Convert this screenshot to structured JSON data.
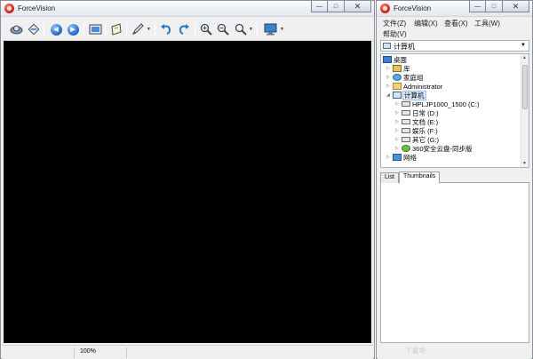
{
  "left_window": {
    "title": "ForceVision",
    "caption": {
      "minimize": "—",
      "maximize": "□",
      "close": "✕"
    },
    "toolbar": [
      {
        "name": "scan-icon",
        "glyph": "⚙"
      },
      {
        "name": "rotate-icon",
        "glyph": "◈"
      },
      {
        "name": "previous-icon",
        "glyph": "◀"
      },
      {
        "name": "next-icon",
        "glyph": "▶"
      },
      {
        "name": "display-icon",
        "glyph": "▭"
      },
      {
        "name": "slideshow-icon",
        "glyph": "⬗"
      },
      {
        "name": "edit-icon",
        "glyph": "✎"
      },
      {
        "name": "undo-icon",
        "glyph": "↶"
      },
      {
        "name": "redo-icon",
        "glyph": "↷"
      },
      {
        "name": "zoom-in-icon",
        "glyph": "⊕"
      },
      {
        "name": "zoom-out-icon",
        "glyph": "⊖"
      },
      {
        "name": "zoom-icon",
        "glyph": "⚲"
      },
      {
        "name": "monitor-icon",
        "glyph": "▣"
      }
    ],
    "status": {
      "zoom": "100%"
    }
  },
  "right_window": {
    "title": "ForceVision",
    "caption": {
      "minimize": "—",
      "maximize": "□",
      "close": "✕"
    },
    "menu": {
      "file": "文件(Z)",
      "edit": "编辑(X)",
      "view": "查看(X)",
      "tools": "工具(W)",
      "help": "帮助(V)"
    },
    "address": {
      "value": "计算机"
    },
    "tree": [
      {
        "label": "桌面",
        "name": "tree-item-desktop"
      },
      {
        "label": "库",
        "name": "tree-item-libraries"
      },
      {
        "label": "家庭组",
        "name": "tree-item-homegroup"
      },
      {
        "label": "Administrator",
        "name": "tree-item-administrator"
      },
      {
        "label": "计算机",
        "name": "tree-item-computer"
      },
      {
        "label": "HPLJP1000_1500 (C:)",
        "name": "tree-item-drive-c"
      },
      {
        "label": "日常 (D:)",
        "name": "tree-item-drive-d"
      },
      {
        "label": "文档 (E:)",
        "name": "tree-item-drive-e"
      },
      {
        "label": "娱乐 (F:)",
        "name": "tree-item-drive-f"
      },
      {
        "label": "其它 (G:)",
        "name": "tree-item-drive-g"
      },
      {
        "label": "360安全云盘-同步版",
        "name": "tree-item-360-cloud"
      },
      {
        "label": "网络",
        "name": "tree-item-network"
      }
    ],
    "tabs": {
      "list": "List",
      "thumbnails": "Thumbnails"
    },
    "watermark": "下载吧"
  }
}
